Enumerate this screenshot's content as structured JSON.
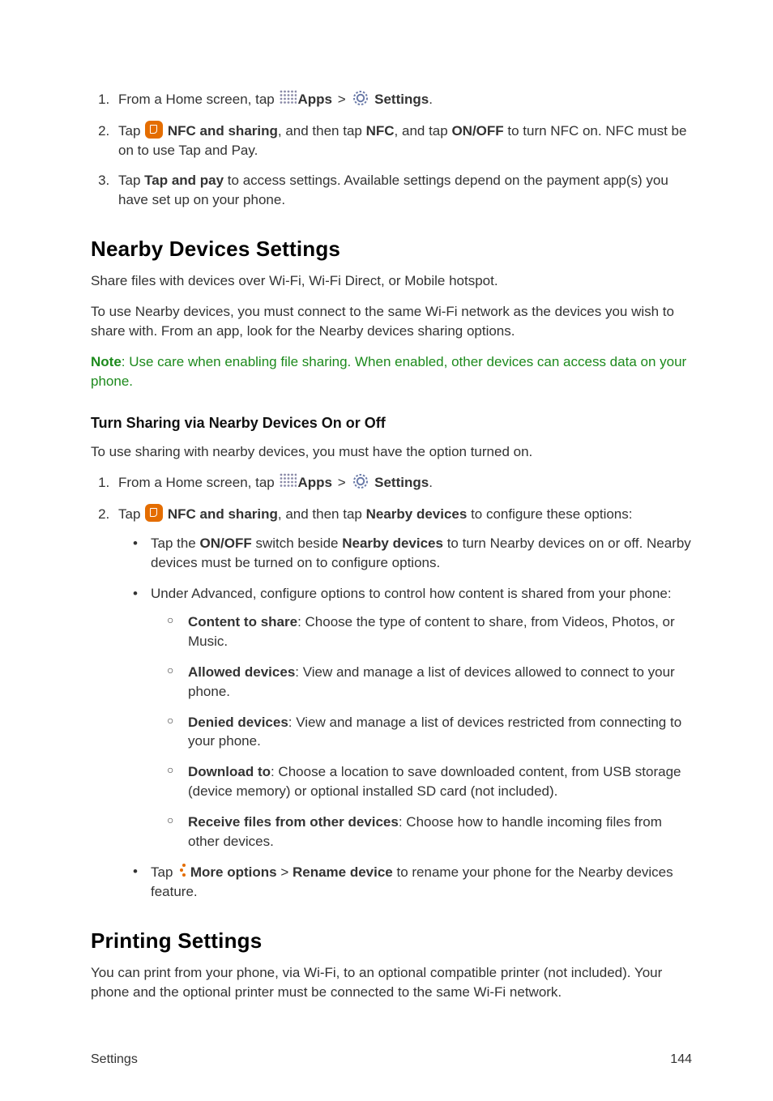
{
  "nav": {
    "from_home": "From a Home screen, tap",
    "apps_label": "Apps",
    "bc_sep": ">",
    "settings_label": "Settings"
  },
  "section_top": {
    "step1_trail": ".",
    "step2_tap": "Tap ",
    "step2_nfc": "NFC and sharing",
    "step2a": ", and then tap ",
    "step2_nfc2": "NFC",
    "step2b": ", and tap ",
    "step2_onoff": "ON/OFF",
    "step2c": " to turn NFC on. NFC must be on to use Tap and Pay.",
    "step3_tap": "Tap ",
    "step3_bold": "Tap and pay",
    "step3_rest": " to access settings. Available settings depend on the payment app(s) you have set up on your phone."
  },
  "nearby": {
    "heading": "Nearby Devices Settings",
    "intro": "Share files with devices over Wi-Fi, Wi-Fi Direct, or Mobile hotspot.",
    "intro2": "To use Nearby devices, you must connect to the same Wi-Fi network as the devices you wish to share with. From an app, look for the Nearby devices sharing options.",
    "note_bold": "Note",
    "note_rest": ": Use care when enabling file sharing. When enabled, other devices can access data on your phone.",
    "sub_heading": "Turn Sharing via Nearby Devices On or Off",
    "sub_intro": "To use sharing with nearby devices, you must have the option turned on.",
    "step2_tap": "Tap ",
    "step2_nfc": "NFC and sharing",
    "step2_rest_a": ", and then tap ",
    "step2_nearby": "Nearby devices",
    "step2_rest_b": " to configure these options:",
    "sub_onoff_a": "Tap the ",
    "sub_onoff_bold1": "ON/OFF",
    "sub_onoff_b": " switch beside ",
    "sub_onoff_bold2": "Nearby devices",
    "sub_onoff_c": " to turn Nearby devices on or off. Nearby devices must be turned on to configure options.",
    "sub_adv": "Under Advanced, configure options to control how content is shared from your phone:",
    "c1_bold": "Content to share",
    "c1_rest": ": Choose the type of content to share, from Videos, Photos, or Music.",
    "c2_bold": "Allowed devices",
    "c2_rest": ": View and manage a list of devices allowed to connect to your phone.",
    "c3_bold": "Denied devices",
    "c3_rest": ": View and manage a list of devices restricted from connecting to your phone.",
    "c4_bold": "Download to",
    "c4_rest": ": Choose a location to save downloaded content, from USB storage (device memory) or optional installed SD card (not included).",
    "c5_bold": "Receive files from other devices",
    "c5_rest": ": Choose how to handle incoming files from other devices.",
    "more_tap": "Tap ",
    "more_bold1": "More options",
    "more_sep": " > ",
    "more_bold2": "Rename device",
    "more_rest": " to rename your phone for the Nearby devices feature."
  },
  "printing": {
    "heading": "Printing Settings",
    "intro": "You can print from your phone, via Wi-Fi, to an optional compatible printer (not included). Your phone and the optional printer must be connected to the same Wi-Fi network."
  },
  "footer": {
    "left": "Settings",
    "right": "144"
  }
}
